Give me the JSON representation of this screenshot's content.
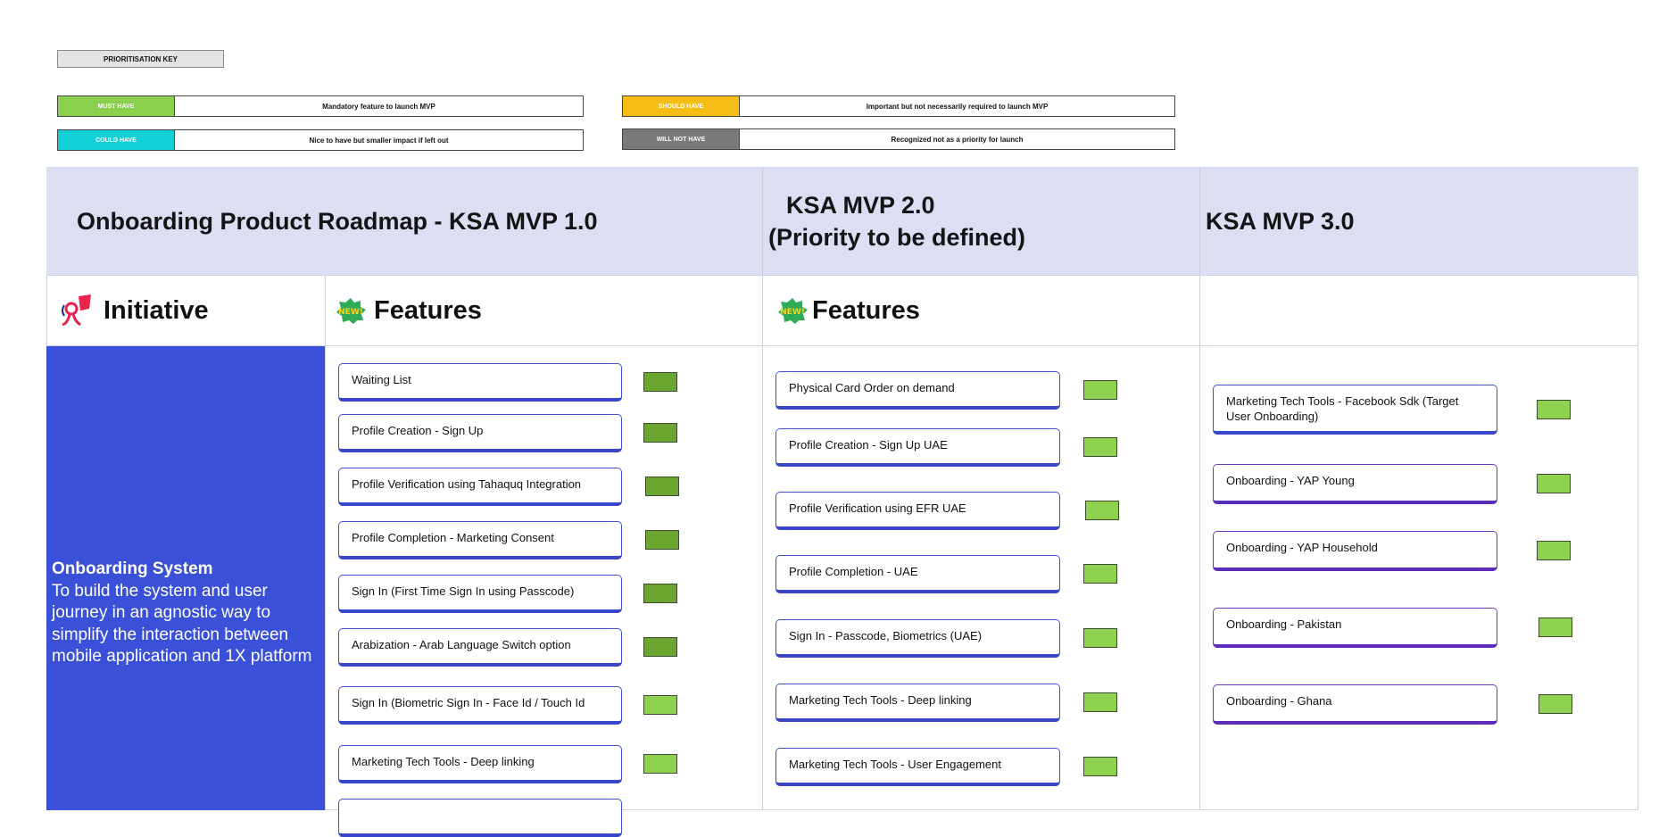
{
  "key": {
    "title": "PRIORITISATION KEY",
    "must_have": {
      "label": "MUST HAVE",
      "desc": "Mandatory feature to launch MVP",
      "color": "#8bd04c"
    },
    "could_have": {
      "label": "COULD HAVE",
      "desc": "Nice to have but smaller impact if left out",
      "color": "#13cfd6"
    },
    "should_have": {
      "label": "SHOULD HAVE",
      "desc": "Important but not necessarily required to launch MVP",
      "color": "#f6bd16"
    },
    "will_not_have": {
      "label": "WILL NOT HAVE",
      "desc": "Recognized not as a priority for launch",
      "color": "#7a7a7a"
    }
  },
  "columns": {
    "mvp1_title": "Onboarding Product Roadmap - KSA MVP 1.0",
    "mvp2_title_line1": "KSA MVP 2.0",
    "mvp2_title_line2": "(Priority to be defined)",
    "mvp3_title": "KSA MVP 3.0"
  },
  "subheaders": {
    "initiative": "Initiative",
    "features_1": "Features",
    "features_2": "Features",
    "new_badge": "NEW!"
  },
  "initiative": {
    "name": "Onboarding System",
    "description": "To build the system and user journey in an agnostic way to simplify the interaction between mobile application and 1X platform"
  },
  "features_mvp1": [
    {
      "label": "Waiting List",
      "shade": "dark"
    },
    {
      "label": "Profile Creation - Sign Up",
      "shade": "dark"
    },
    {
      "label": "Profile Verification using Tahaquq Integration",
      "shade": "dark"
    },
    {
      "label": "Profile Completion - Marketing Consent",
      "shade": "dark"
    },
    {
      "label": "Sign In (First Time Sign In using Passcode)",
      "shade": "dark"
    },
    {
      "label": "Arabization - Arab Language Switch option",
      "shade": "dark"
    },
    {
      "label": "Sign In (Biometric Sign In - Face Id / Touch Id",
      "shade": "light"
    },
    {
      "label": "Marketing Tech Tools - Deep linking",
      "shade": "light"
    },
    {
      "label": "",
      "shade": "none"
    }
  ],
  "features_mvp2": [
    {
      "label": "Physical Card Order on demand",
      "shade": "light"
    },
    {
      "label": "Profile Creation - Sign Up UAE",
      "shade": "light"
    },
    {
      "label": "Profile Verification using EFR UAE",
      "shade": "light"
    },
    {
      "label": "Profile Completion - UAE",
      "shade": "light"
    },
    {
      "label": "Sign In - Passcode, Biometrics (UAE)",
      "shade": "light"
    },
    {
      "label": "Marketing Tech Tools - Deep linking",
      "shade": "light"
    },
    {
      "label": "Marketing Tech Tools - User Engagement",
      "shade": "light"
    }
  ],
  "features_mvp3": [
    {
      "label": "Marketing Tech Tools - Facebook Sdk (Target User Onboarding)",
      "shade": "light"
    },
    {
      "label": "Onboarding - YAP Young",
      "shade": "light"
    },
    {
      "label": "Onboarding - YAP Household",
      "shade": "light"
    },
    {
      "label": "Onboarding - Pakistan",
      "shade": "light"
    },
    {
      "label": "Onboarding - Ghana",
      "shade": "light"
    }
  ]
}
